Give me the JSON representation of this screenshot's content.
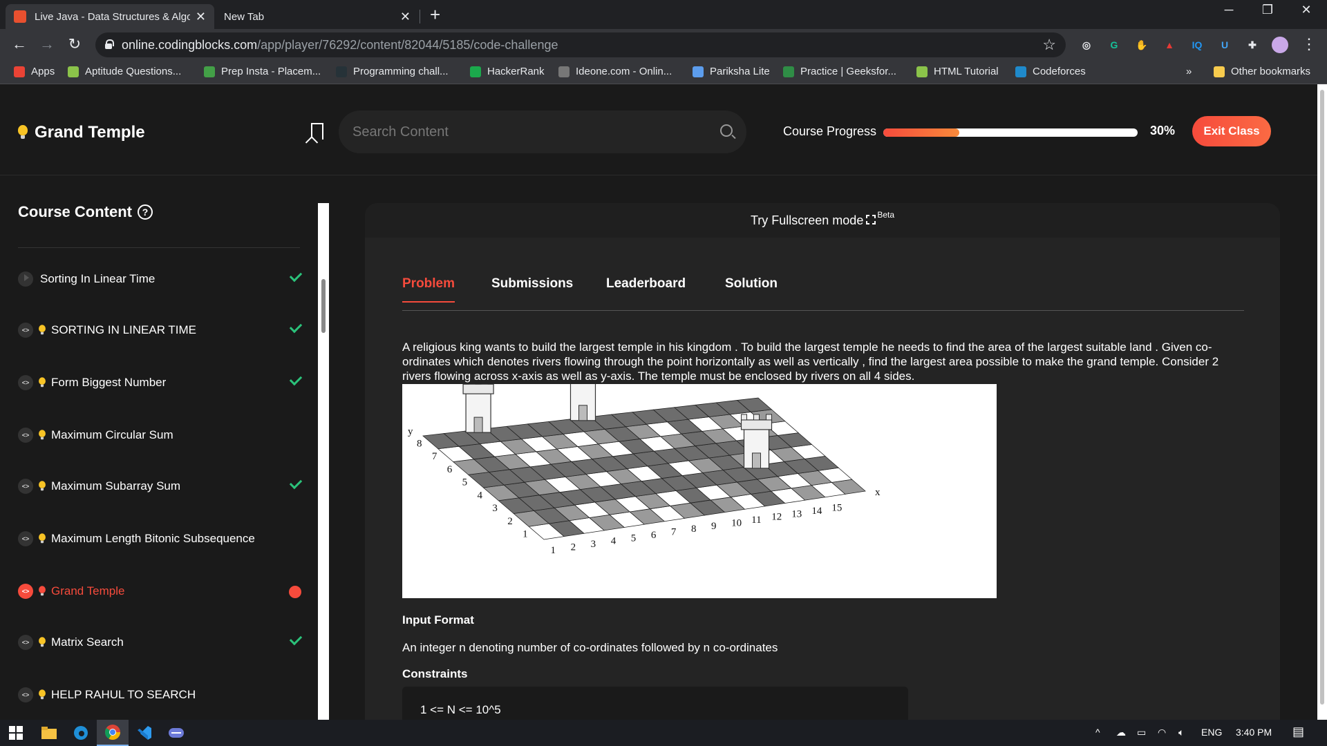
{
  "browser": {
    "tabs": [
      {
        "title": "Live Java - Data Structures & Algo",
        "active": true
      },
      {
        "title": "New Tab",
        "active": false
      }
    ],
    "url_host": "online.codingblocks.com",
    "url_path": "/app/player/76292/content/82044/5185/code-challenge",
    "bookmarks": [
      {
        "label": "Apps",
        "color": "#ea4335"
      },
      {
        "label": "Aptitude Questions...",
        "color": "#8bc34a"
      },
      {
        "label": "Prep Insta - Placem...",
        "color": "#43a047"
      },
      {
        "label": "Programming chall...",
        "color": "#263238"
      },
      {
        "label": "HackerRank",
        "color": "#1ba94c"
      },
      {
        "label": "Ideone.com - Onlin...",
        "color": "#777777"
      },
      {
        "label": "Pariksha Lite",
        "color": "#5c9ded"
      },
      {
        "label": "Practice | Geeksfor...",
        "color": "#2f8d46"
      },
      {
        "label": "HTML Tutorial",
        "color": "#8bc34a"
      },
      {
        "label": "Codeforces",
        "color": "#1f8acb"
      }
    ],
    "other_bookmarks": "Other bookmarks",
    "overflow": "»",
    "extensions": [
      {
        "icon": "glasses-icon",
        "glyph": "◎",
        "color": "#e8eaed"
      },
      {
        "icon": "grammarly-icon",
        "glyph": "G",
        "color": "#15c39a"
      },
      {
        "icon": "hand-icon",
        "glyph": "✋",
        "color": "#f57c00"
      },
      {
        "icon": "chart-icon",
        "glyph": "▲",
        "color": "#e53935"
      },
      {
        "icon": "iq-icon",
        "glyph": "IQ",
        "color": "#2196f3"
      },
      {
        "icon": "cup-icon",
        "glyph": "U",
        "color": "#42a5f5"
      },
      {
        "icon": "puzzle-icon",
        "glyph": "✚",
        "color": "#e8eaed"
      }
    ]
  },
  "header": {
    "title": "Grand Temple",
    "search_placeholder": "Search Content",
    "progress_label": "Course Progress",
    "progress_value": 0.3,
    "progress_text": "30%",
    "exit_label": "Exit Class"
  },
  "sidebar": {
    "title": "Course Content",
    "help": "?",
    "items": [
      {
        "label": "Sorting In Linear Time",
        "kind": "video",
        "bulb": false,
        "status": "done"
      },
      {
        "label": "SORTING IN LINEAR TIME",
        "kind": "code",
        "bulb": true,
        "status": "done"
      },
      {
        "label": "Form Biggest Number",
        "kind": "code",
        "bulb": true,
        "status": "done"
      },
      {
        "label": "Maximum Circular Sum",
        "kind": "code",
        "bulb": true,
        "status": "none"
      },
      {
        "label": "Maximum Subarray Sum",
        "kind": "code",
        "bulb": true,
        "status": "done"
      },
      {
        "label": "Maximum Length Bitonic Subsequence",
        "kind": "code",
        "bulb": true,
        "status": "none"
      },
      {
        "label": "Grand Temple",
        "kind": "code",
        "bulb": true,
        "status": "current"
      },
      {
        "label": "Matrix Search",
        "kind": "code",
        "bulb": true,
        "status": "done"
      },
      {
        "label": "HELP RAHUL TO SEARCH",
        "kind": "code",
        "bulb": true,
        "status": "none"
      }
    ]
  },
  "main": {
    "fullscreen_text": "Try Fullscreen mode",
    "beta": "Beta",
    "tabs": [
      "Problem",
      "Submissions",
      "Leaderboard",
      "Solution"
    ],
    "description": "A religious king wants to build the largest temple in his kingdom . To build the largest temple he needs to find the area of the largest suitable land . Given co-ordinates which denotes rivers flowing through the point horizontally as well as vertically , find the largest area possible to make the grand temple. Consider 2 rivers flowing across x-axis as well as y-axis. The temple must be enclosed by rivers on all 4 sides.",
    "figure": {
      "y_axis_letter": "y",
      "x_axis_letter": "x",
      "y_numbers": [
        "1",
        "2",
        "3",
        "4",
        "5",
        "6",
        "7",
        "8"
      ],
      "x_numbers": [
        "1",
        "2",
        "3",
        "4",
        "5",
        "6",
        "7",
        "8",
        "9",
        "10",
        "11",
        "12",
        "13",
        "14",
        "15"
      ],
      "rivers_x": [
        1,
        8,
        11
      ],
      "rivers_y": [
        2,
        4,
        7
      ],
      "towers": [
        [
          2.5,
          7.8
        ],
        [
          7.5,
          7.8
        ],
        [
          12.5,
          2.8
        ]
      ]
    },
    "input_heading": "Input Format",
    "input_text": "An integer n denoting number of co-ordinates followed by n co-ordinates",
    "constraints_heading": "Constraints",
    "constraints_text": "1 <= N <= 10^5"
  },
  "taskbar": {
    "lang": "ENG",
    "time": "3:40 PM",
    "caret": "^"
  }
}
